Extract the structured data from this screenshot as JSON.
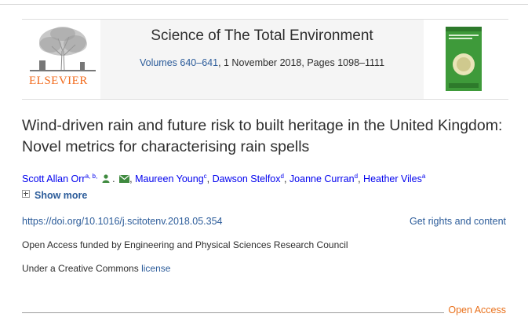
{
  "journal": {
    "publisher": "ELSEVIER",
    "title": "Science of The Total Environment",
    "volume_link": "Volumes 640–641",
    "volume_rest": ", 1 November 2018, Pages 1098–1111"
  },
  "article": {
    "title": "Wind-driven rain and future risk to built heritage in the United Kingdom: Novel metrics for characterising rain spells"
  },
  "authors": [
    {
      "name": "Scott Allan Orr",
      "sup": "a, b,"
    },
    {
      "name": "Maureen Young",
      "sup": "c"
    },
    {
      "name": "Dawson Stelfox",
      "sup": "d"
    },
    {
      "name": "Joanne Curran",
      "sup": "d"
    },
    {
      "name": "Heather Viles",
      "sup": "a"
    }
  ],
  "show_more": "Show more",
  "doi": "https://doi.org/10.1016/j.scitotenv.2018.05.354",
  "rights": "Get rights and content",
  "funding": "Open Access funded by Engineering and Physical Sciences Research Council",
  "license": {
    "prefix": "Under a Creative Commons ",
    "link": "license"
  },
  "open_access": "Open Access",
  "colors": {
    "link": "#2c5c9a",
    "elsevier_orange": "#f26b1d",
    "open_access": "#e9711c"
  },
  "icons": [
    "plus-icon",
    "person-icon",
    "mail-icon",
    "elsevier-tree-logo",
    "journal-cover"
  ]
}
